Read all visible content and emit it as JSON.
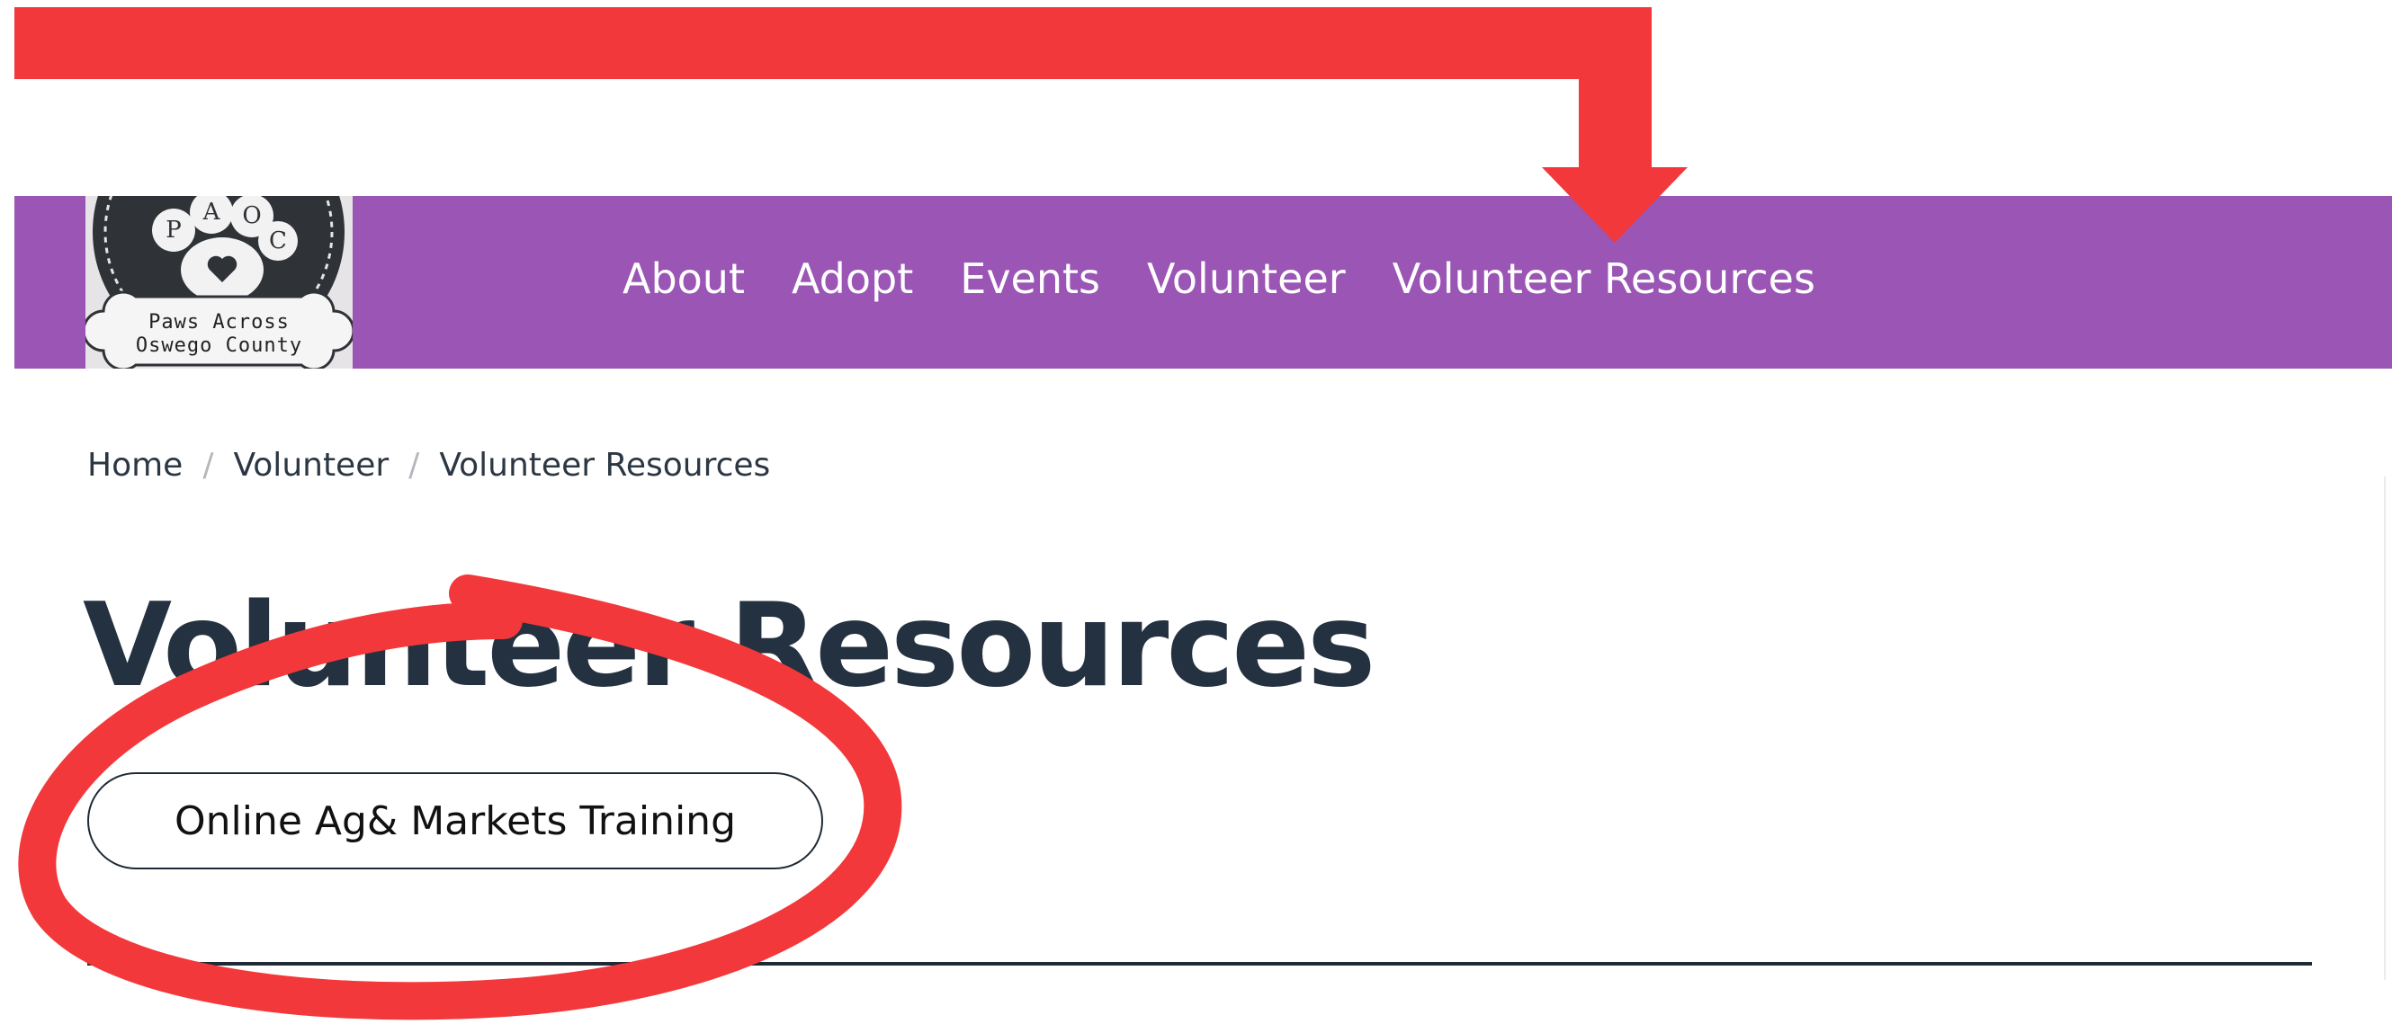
{
  "logo": {
    "letters": [
      "P",
      "A",
      "O",
      "C"
    ],
    "line1": "Paws Across",
    "line2": "Oswego County"
  },
  "nav": {
    "items": [
      {
        "label": "About"
      },
      {
        "label": "Adopt"
      },
      {
        "label": "Events"
      },
      {
        "label": "Volunteer"
      },
      {
        "label": "Volunteer Resources"
      }
    ]
  },
  "breadcrumb": {
    "items": [
      "Home",
      "Volunteer",
      "Volunteer Resources"
    ],
    "separator": "/"
  },
  "page": {
    "title": "Volunteer Resources",
    "button_label": "Online Ag& Markets Training"
  },
  "colors": {
    "nav_background": "#9a55b5",
    "title_text": "#243140",
    "annotation_red": "#f2383a"
  }
}
